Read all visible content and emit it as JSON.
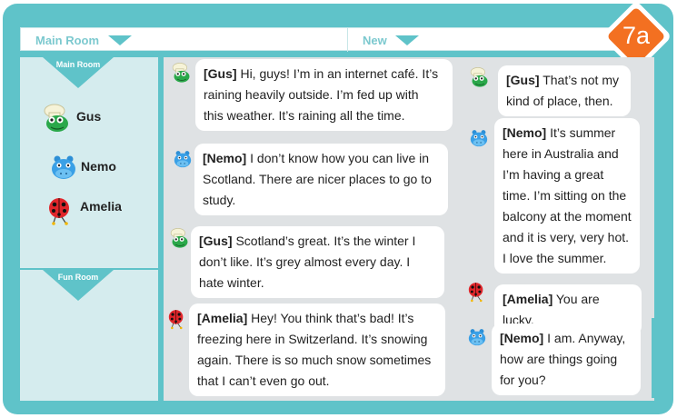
{
  "badge": "7a",
  "tabs": {
    "main_room": "Main Room",
    "new": "New"
  },
  "sidebar": {
    "main_room_label": "Main Room",
    "fun_room_label": "Fun Room",
    "users": [
      {
        "name": "Gus",
        "avatar": "chef-frog-icon"
      },
      {
        "name": "Nemo",
        "avatar": "blue-hippo-icon"
      },
      {
        "name": "Amelia",
        "avatar": "ladybird-icon"
      }
    ]
  },
  "messages_left": [
    {
      "user": "[Gus]",
      "lines": [
        "Hi, guys! I’m in an internet café. It’s",
        "raining heavily outside. I’m fed up with",
        "this weather. It’s raining all the time."
      ]
    },
    {
      "user": "[Nemo]",
      "lines": [
        "I don’t know how you can live in",
        "Scotland. There are nicer places to go to",
        "study."
      ]
    },
    {
      "user": "[Gus]",
      "lines": [
        "Scotland’s great. It’s the winter I",
        "don’t like. It’s grey almost every day. I",
        "hate winter."
      ]
    },
    {
      "user": "[Amelia]",
      "lines": [
        "Hey! You think that’s bad! It’s",
        "freezing here in Switzerland. It’s snowing",
        "again. There is so much snow sometimes",
        "that I can’t even go out."
      ]
    }
  ],
  "messages_right": [
    {
      "user": "[Gus]",
      "lines": [
        "That’s not my",
        "kind of place, then."
      ]
    },
    {
      "user": "[Nemo]",
      "lines": [
        "It’s summer",
        "here in Australia and",
        "I’m having a great",
        "time. I’m sitting on the",
        "balcony at the moment",
        "and it is very, very hot.",
        "I love the summer."
      ]
    },
    {
      "user": "[Amelia]",
      "lines": [
        "You are lucky."
      ]
    },
    {
      "user": "[Nemo]",
      "lines": [
        "I am. Anyway,",
        "how are things going",
        "for you?"
      ]
    }
  ]
}
